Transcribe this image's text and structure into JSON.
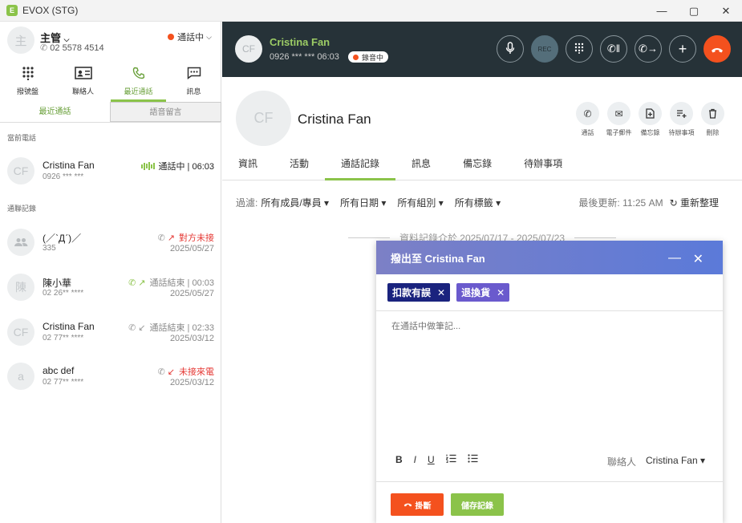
{
  "window": {
    "title": "EVOX (STG)",
    "logo": "E"
  },
  "me": {
    "avatar": "主",
    "name": "主管",
    "phone": "02 5578 4514",
    "status": "通話中"
  },
  "nav": [
    {
      "label": "撥號盤",
      "icon": "dialpad-icon"
    },
    {
      "label": "聯絡人",
      "icon": "contacts-icon"
    },
    {
      "label": "最近通話",
      "icon": "phone-icon"
    },
    {
      "label": "訊息",
      "icon": "message-icon"
    }
  ],
  "subtabs": {
    "recent": "最近通話",
    "voicemail": "語音留言"
  },
  "sections": {
    "current": "當前電話",
    "history": "通聯記錄"
  },
  "current_call": {
    "avatar": "CF",
    "name": "Cristina Fan",
    "number": "0926 *** ***",
    "status": "通話中 | 06:03"
  },
  "history": [
    {
      "avatar": "icon",
      "name": "(／ˋДˊ)／",
      "number": "335",
      "status": "對方未接",
      "date": "2025/05/27"
    },
    {
      "avatar": "陳",
      "name": "陳小華",
      "number": "02 26** ****",
      "status": "通話結束 | 00:03",
      "date": "2025/05/27"
    },
    {
      "avatar": "CF",
      "name": "Cristina Fan",
      "number": "02 77** ****",
      "status": "通話結束 | 02:33",
      "date": "2025/03/12"
    },
    {
      "avatar": "a",
      "name": "abc def",
      "number": "02 77** ****",
      "status": "未接來電",
      "date": "2025/03/12"
    }
  ],
  "call": {
    "avatar": "CF",
    "name": "Cristina Fan",
    "number": "0926 *** ***",
    "timer": "06:03",
    "recording": "錄音中",
    "rec_label": "REC"
  },
  "contact": {
    "avatar": "CF",
    "name": "Cristina Fan"
  },
  "actions": [
    {
      "label": "通話",
      "icon": "phone-icon"
    },
    {
      "label": "電子郵件",
      "icon": "mail-icon"
    },
    {
      "label": "備忘錄",
      "icon": "note-icon"
    },
    {
      "label": "待辦事項",
      "icon": "todo-icon"
    },
    {
      "label": "刪除",
      "icon": "trash-icon"
    }
  ],
  "content_tabs": [
    "資訊",
    "活動",
    "通話記錄",
    "訊息",
    "備忘錄",
    "待辦事項"
  ],
  "filters": {
    "label": "過濾:",
    "members": "所有成員/專員",
    "dates": "所有日期",
    "groups": "所有組別",
    "tags": "所有標籤"
  },
  "updated": {
    "text": "最後更新: 11:25 AM",
    "refresh": "重新整理"
  },
  "range": "資料記錄介於 2025/07/17 - 2025/07/23",
  "modal": {
    "title": "撥出至 Cristina Fan",
    "tags": [
      "扣款有誤",
      "退換貨"
    ],
    "placeholder": "在通話中做筆記...",
    "assoc_label": "聯絡人",
    "assoc_value": "Cristina Fan",
    "hangup": "掛斷",
    "save": "儲存記錄"
  },
  "format_tools": [
    "B",
    "I",
    "U"
  ]
}
